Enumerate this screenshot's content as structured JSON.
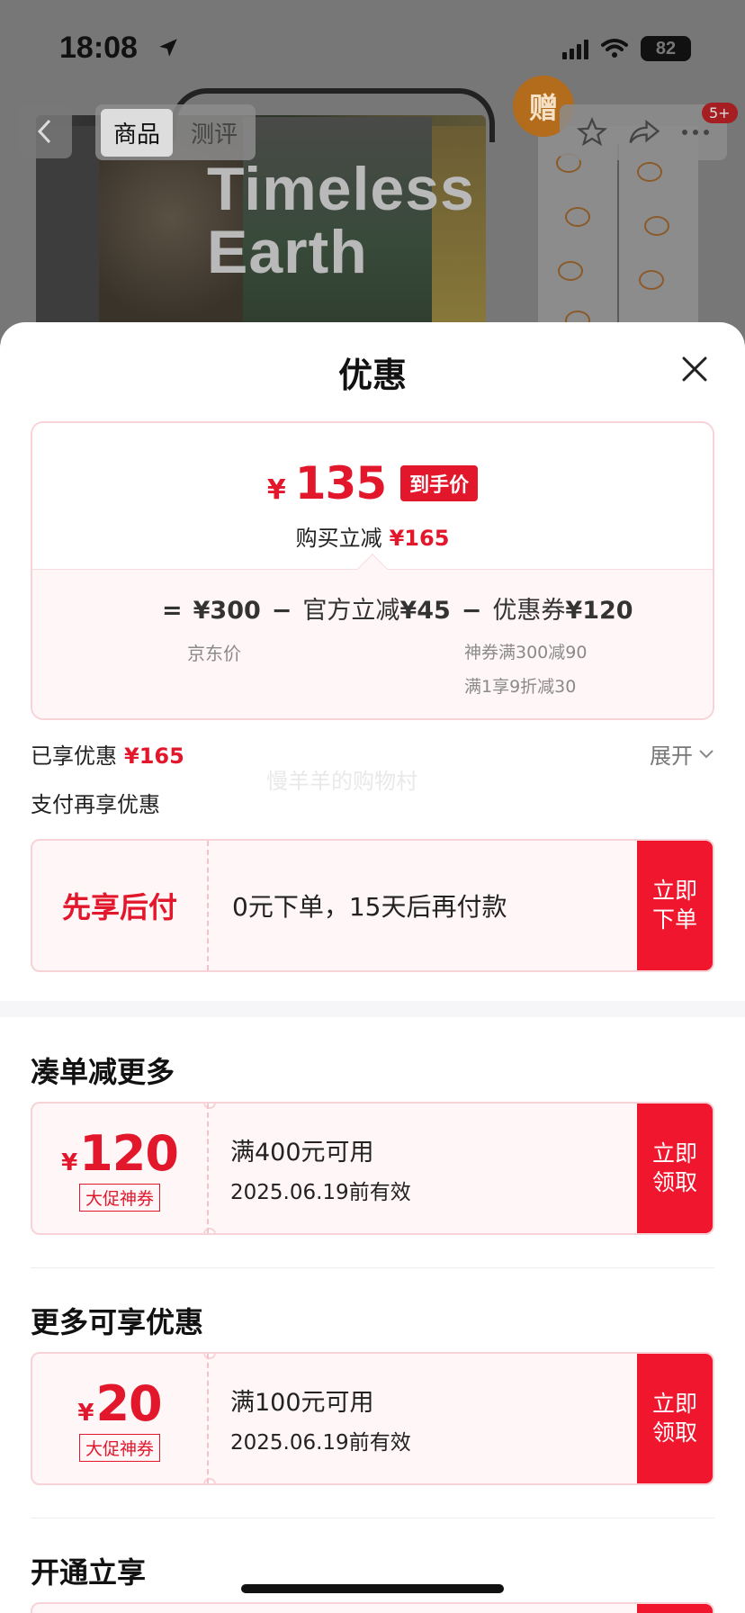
{
  "status_bar": {
    "time": "18:08",
    "battery": "82"
  },
  "background": {
    "tabs": [
      {
        "label": "商品"
      },
      {
        "label": "测评"
      }
    ],
    "gift_label": "赠",
    "badge": "5+",
    "box_title_line1": "Timeless",
    "box_title_line2": "Earth"
  },
  "sheet": {
    "title": "优惠",
    "final": {
      "yen": "¥",
      "price": "135",
      "tag": "到手价",
      "reduce_label": "购买立减",
      "reduce_value": "¥165"
    },
    "formula": {
      "eq": "=",
      "jd_price": "¥300",
      "minus1": "−",
      "official_label": "官方立减",
      "official_value": "¥45",
      "minus2": "−",
      "coupon_label": "优惠券",
      "coupon_value": "¥120",
      "jd_price_label": "京东价",
      "coupon_note1": "神券满300减90",
      "coupon_note2": "满1享9折减30"
    },
    "enjoyed_label": "已享优惠",
    "enjoyed_value": "¥165",
    "expand_label": "展开",
    "watermark": "慢羊羊的购物村",
    "pay_more_label": "支付再享优惠",
    "bnpl": {
      "title": "先享后付",
      "desc": "0元下单，15天后再付款",
      "cta": "立即下单"
    },
    "sections": [
      {
        "title": "凑单减更多",
        "coupon": {
          "yen": "¥",
          "amount": "120",
          "tag": "大促神券",
          "condition": "满400元可用",
          "valid": "2025.06.19前有效",
          "cta": "立即领取"
        }
      },
      {
        "title": "更多可享优惠",
        "coupon": {
          "yen": "¥",
          "amount": "20",
          "tag": "大促神券",
          "condition": "满100元可用",
          "valid": "2025.06.19前有效",
          "cta": "立即领取"
        }
      },
      {
        "title": "开通立享"
      }
    ]
  },
  "colors": {
    "accent_red": "#e3172b",
    "cta_red": "#f0162d",
    "card_pink": "#fff6f7"
  }
}
